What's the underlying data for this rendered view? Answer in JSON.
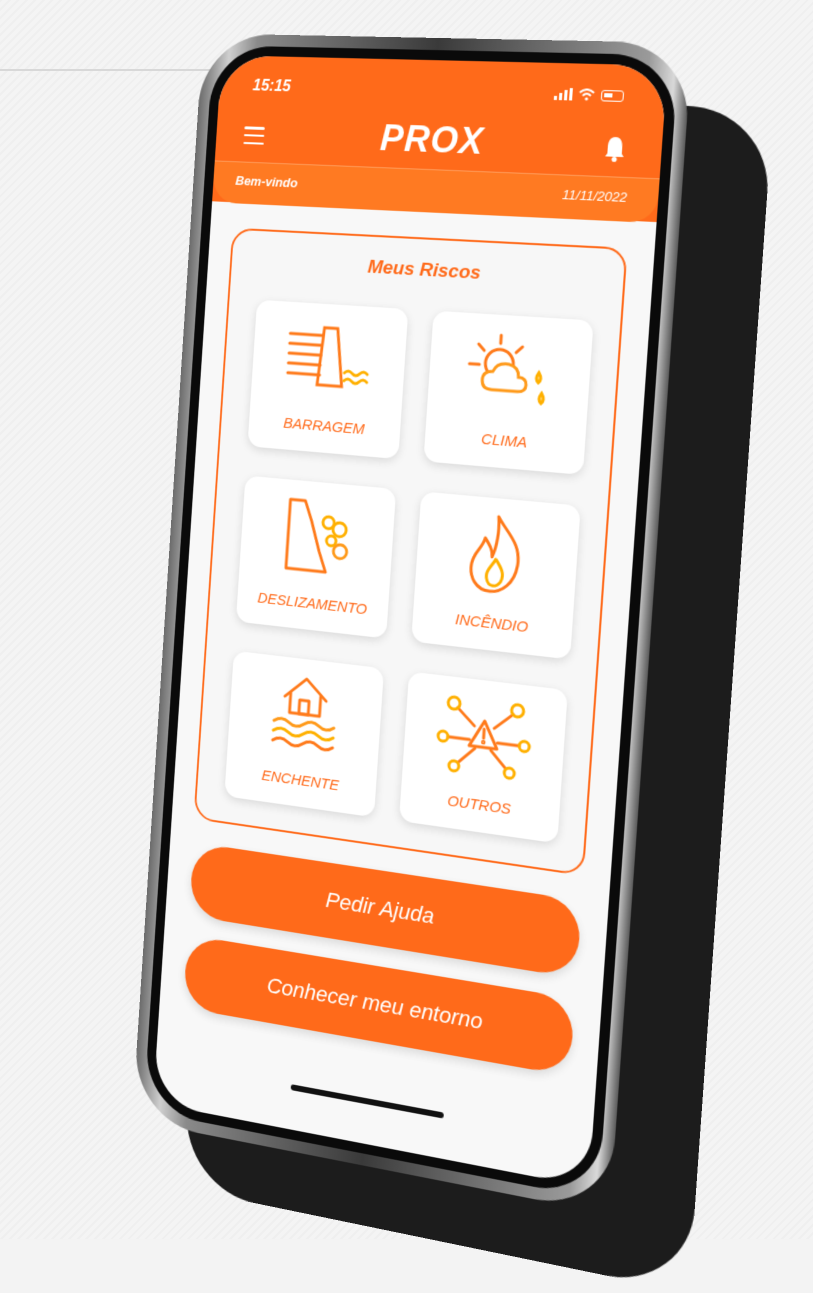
{
  "status_bar": {
    "time": "15:15"
  },
  "header": {
    "app_title": "PROX",
    "welcome": "Bem-vindo",
    "date": "11/11/2022"
  },
  "risks": {
    "title": "Meus Riscos",
    "items": [
      {
        "label": "BARRAGEM",
        "icon": "dam-icon"
      },
      {
        "label": "CLIMA",
        "icon": "weather-icon"
      },
      {
        "label": "DESLIZAMENTO",
        "icon": "landslide-icon"
      },
      {
        "label": "INCÊNDIO",
        "icon": "fire-icon"
      },
      {
        "label": "ENCHENTE",
        "icon": "flood-icon"
      },
      {
        "label": "OUTROS",
        "icon": "network-warning-icon"
      }
    ]
  },
  "actions": {
    "help_label": "Pedir Ajuda",
    "surroundings_label": "Conhecer meu entorno"
  },
  "colors": {
    "accent": "#ff6a1a",
    "accent_light": "#ffb000"
  }
}
